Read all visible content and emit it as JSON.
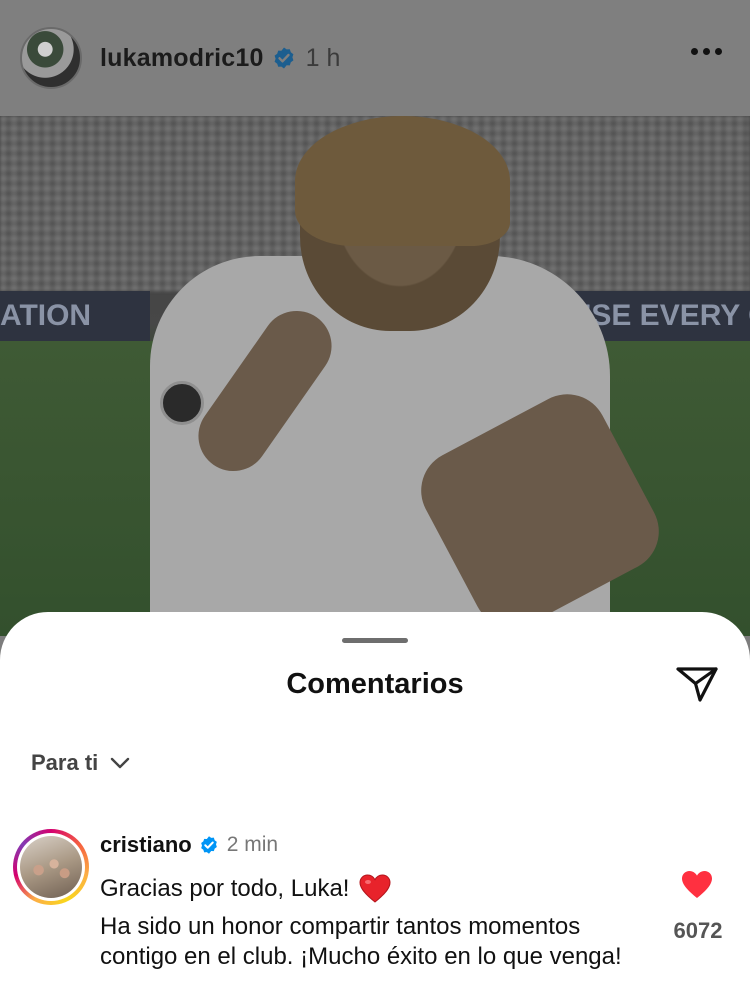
{
  "post": {
    "username": "lukamodric10",
    "time": "1 h",
    "billboard_left": "ATION",
    "billboard_right": "AUSE EVERY CH"
  },
  "comments_sheet": {
    "title": "Comentarios",
    "filter_label": "Para ti"
  },
  "comment": {
    "username": "cristiano",
    "time": "2 min",
    "line1": "Gracias por todo, Luka!",
    "body": "Ha sido un honor compartir tantos momentos contigo en el club. ¡Mucho éxito en lo que venga!",
    "likes": "6072"
  },
  "colors": {
    "verified": "#0095f6",
    "like": "#ff3040"
  },
  "icons": [
    "verified-badge-icon",
    "more-options-icon",
    "share-icon",
    "chevron-down-icon",
    "heart-icon",
    "red-heart-emoji-icon"
  ]
}
